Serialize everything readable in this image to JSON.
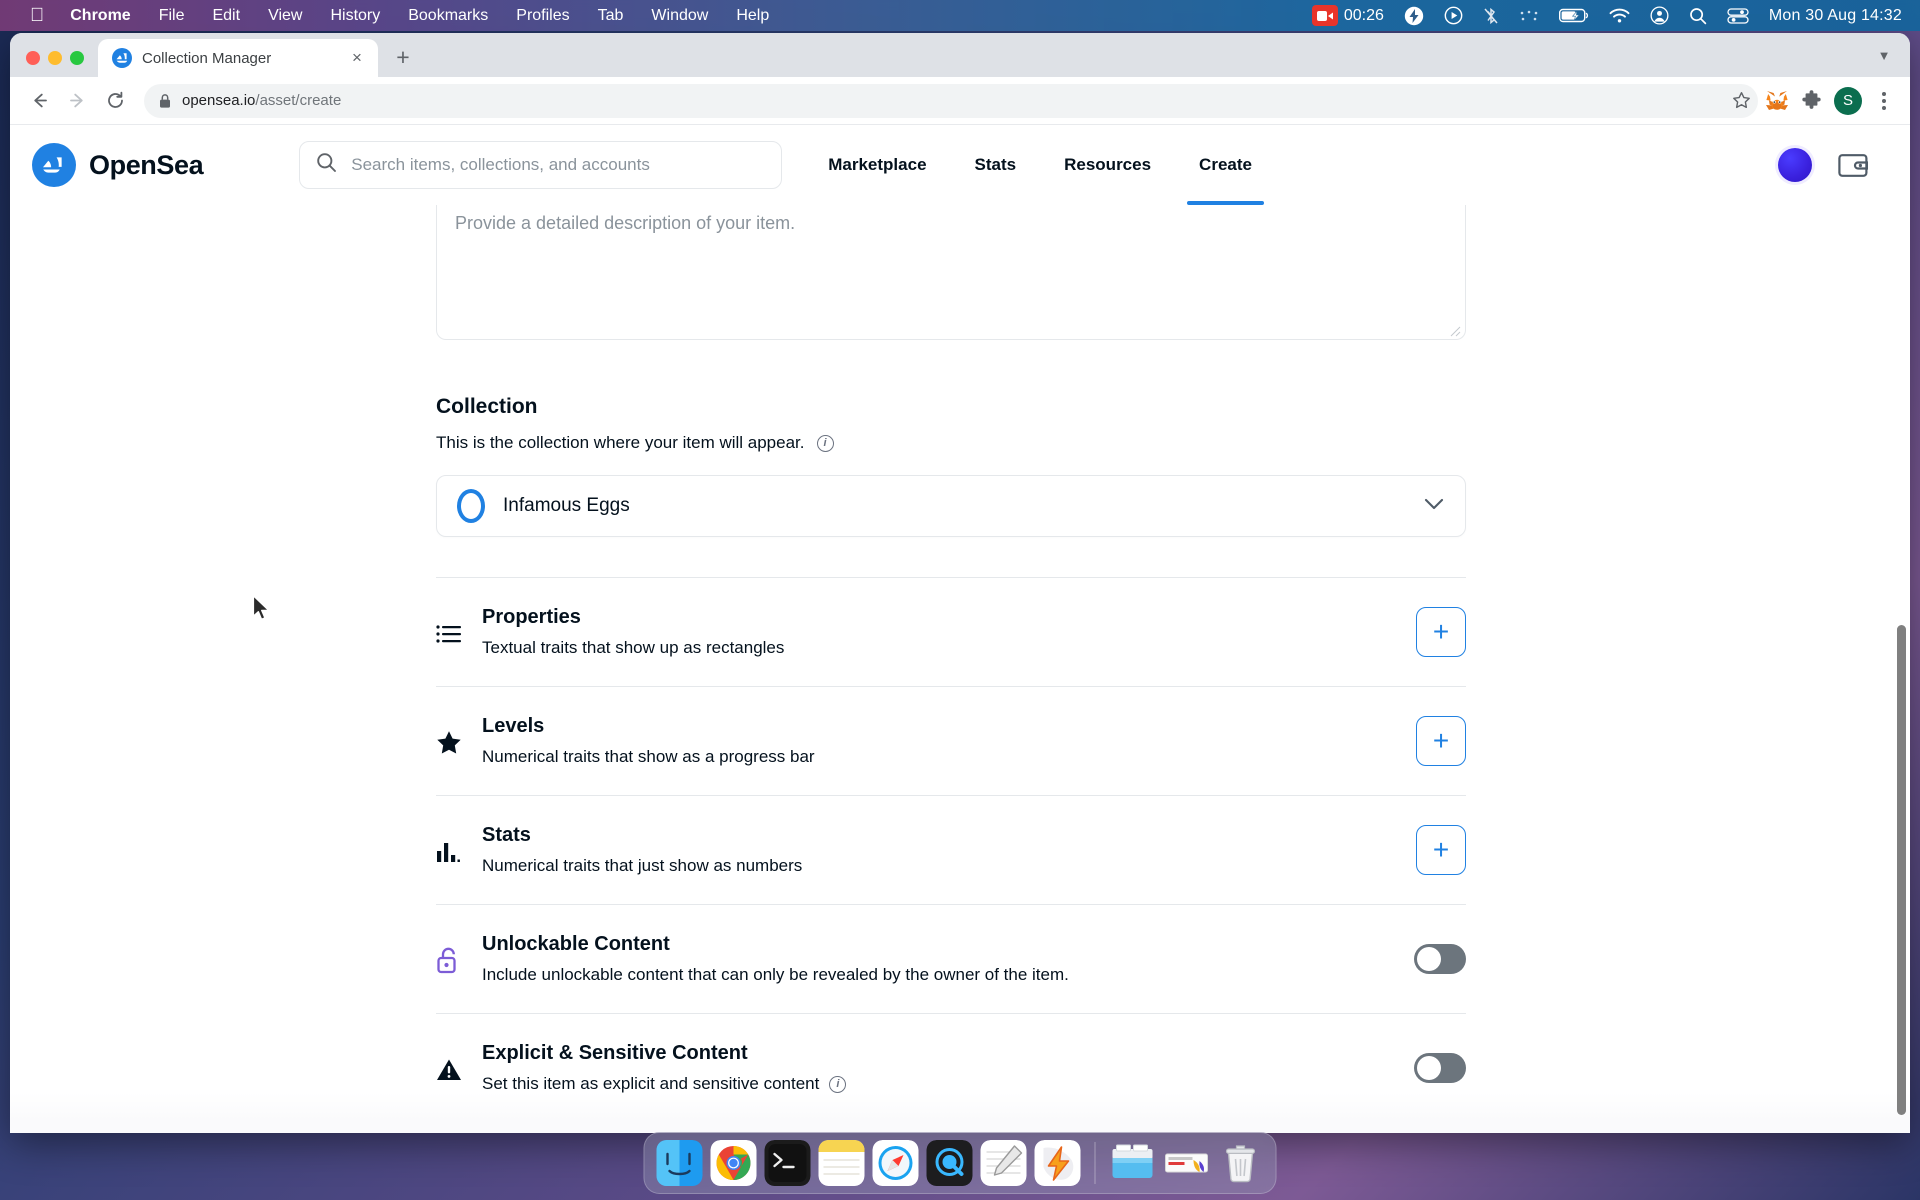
{
  "menubar": {
    "apple_icon": "apple-logo",
    "items": [
      {
        "label": "Chrome",
        "bold": true
      },
      {
        "label": "File",
        "bold": false
      },
      {
        "label": "Edit",
        "bold": false
      },
      {
        "label": "View",
        "bold": false
      },
      {
        "label": "History",
        "bold": false
      },
      {
        "label": "Bookmarks",
        "bold": false
      },
      {
        "label": "Profiles",
        "bold": false
      },
      {
        "label": "Tab",
        "bold": false
      },
      {
        "label": "Window",
        "bold": false
      },
      {
        "label": "Help",
        "bold": false
      }
    ],
    "recording_time": "00:26",
    "status_icons": [
      "screen-record-icon",
      "bolt-icon",
      "play-circle-icon",
      "bluetooth-off-icon",
      "dots-icon",
      "battery-charging-icon",
      "wifi-icon",
      "account-icon",
      "search-icon",
      "control-center-icon"
    ],
    "clock": "Mon 30 Aug  14:32"
  },
  "browser": {
    "tab": {
      "title": "Collection Manager",
      "favicon": "opensea-favicon",
      "close_label": "×"
    },
    "new_tab_label": "+",
    "url_secure_prefix": "opensea.io",
    "url_path": "/asset/create",
    "toolbar_icons": [
      "back-icon",
      "forward-icon",
      "reload-icon",
      "bookmark-star-icon",
      "metamask-icon",
      "extensions-icon",
      "profile-avatar",
      "chrome-menu-icon"
    ],
    "profile_initial": "S"
  },
  "opensea": {
    "brand": "OpenSea",
    "search": {
      "placeholder": "Search items, collections, and accounts"
    },
    "nav": [
      {
        "label": "Marketplace",
        "active": false
      },
      {
        "label": "Stats",
        "active": false
      },
      {
        "label": "Resources",
        "active": false
      },
      {
        "label": "Create",
        "active": true
      }
    ]
  },
  "form": {
    "description_placeholder": "Provide a detailed description of your item.",
    "collection": {
      "title": "Collection",
      "subtitle": "This is the collection where your item will appear.",
      "selected": "Infamous Eggs"
    },
    "traits": [
      {
        "icon": "list-icon",
        "title": "Properties",
        "subtitle": "Textual traits that show up as rectangles",
        "control": "plus",
        "control_label": "+"
      },
      {
        "icon": "star-icon",
        "title": "Levels",
        "subtitle": "Numerical traits that show as a progress bar",
        "control": "plus",
        "control_label": "+"
      },
      {
        "icon": "bar-chart-icon",
        "title": "Stats",
        "subtitle": "Numerical traits that just show as numbers",
        "control": "plus",
        "control_label": "+"
      },
      {
        "icon": "unlock-icon",
        "title": "Unlockable Content",
        "subtitle": "Include unlockable content that can only be revealed by the owner of the item.",
        "control": "toggle",
        "control_state": "off"
      },
      {
        "icon": "warning-triangle-icon",
        "title": "Explicit & Sensitive Content",
        "subtitle": "Set this item as explicit and sensitive content",
        "control": "toggle",
        "control_state": "off",
        "has_info": true
      }
    ]
  },
  "dock": {
    "apps": [
      "finder-icon",
      "chrome-icon",
      "terminal-icon",
      "notes-icon",
      "safari-icon",
      "quicktime-icon",
      "textedit-icon",
      "bolt-app-icon"
    ],
    "utilities": [
      "downloads-folder-icon",
      "stack-icon",
      "trash-icon"
    ]
  },
  "colors": {
    "accent_blue": "#2081e2",
    "brand_dark": "#04111d",
    "muted": "#8a939b",
    "toggle_off": "#6c757d",
    "purple": "#7c5cd6"
  }
}
